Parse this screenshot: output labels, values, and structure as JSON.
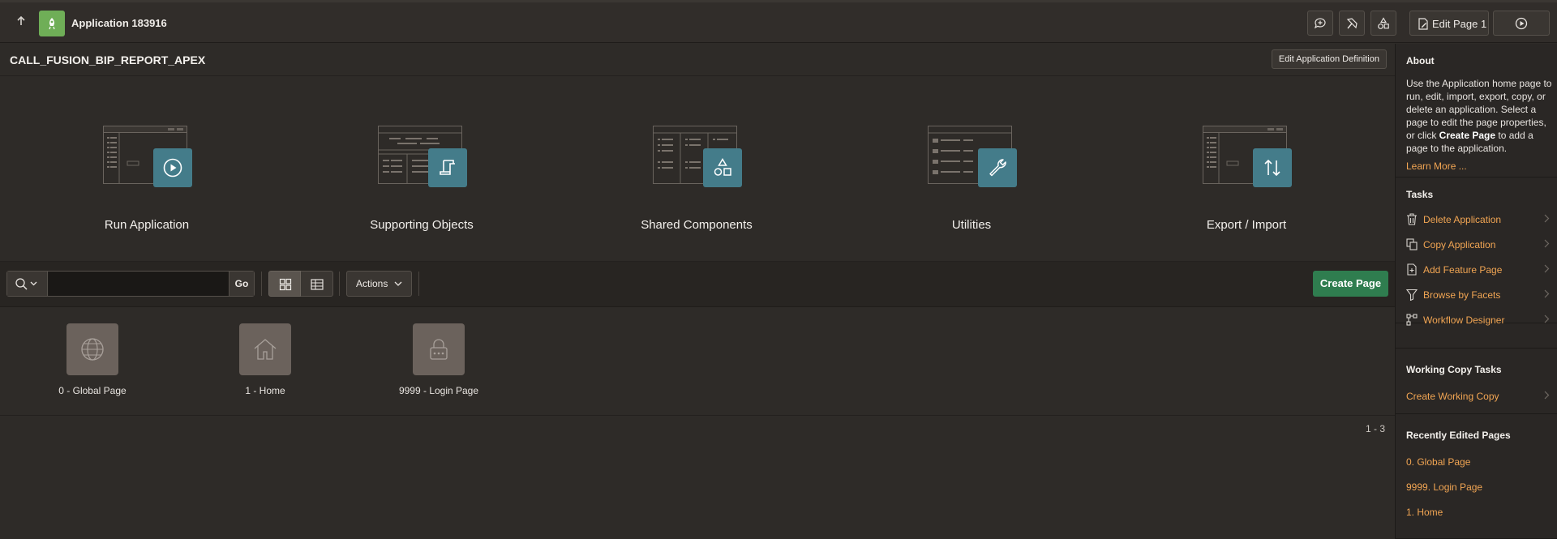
{
  "header": {
    "app_title": "Application 183916",
    "edit_page_label": "Edit Page 1",
    "icon_names": [
      "up-arrow-icon",
      "rocket-icon",
      "comment-add-icon",
      "flashlight-icon",
      "shapes-icon",
      "page-edit-icon",
      "play-circle-icon"
    ]
  },
  "app": {
    "name": "CALL_FUSION_BIP_REPORT_APEX",
    "edit_definition_label": "Edit Application Definition"
  },
  "main_actions": [
    {
      "label": "Run Application",
      "icon": "play-circle-icon"
    },
    {
      "label": "Supporting Objects",
      "icon": "scroll-icon"
    },
    {
      "label": "Shared Components",
      "icon": "shapes-icon"
    },
    {
      "label": "Utilities",
      "icon": "wrench-icon"
    },
    {
      "label": "Export / Import",
      "icon": "arrows-up-down-icon"
    }
  ],
  "toolbar": {
    "search_value": "",
    "search_placeholder": "",
    "go_label": "Go",
    "actions_label": "Actions",
    "create_page_label": "Create Page"
  },
  "pages": [
    {
      "label": "0 - Global Page",
      "icon": "globe-icon"
    },
    {
      "label": "1 - Home",
      "icon": "home-icon"
    },
    {
      "label": "9999 - Login Page",
      "icon": "lock-icon"
    }
  ],
  "pagination": "1 - 3",
  "sidebar": {
    "about": {
      "title": "About",
      "text_before": "Use the Application home page to run, edit, import, export, copy, or delete an application. Select a page to edit the page properties, or click ",
      "text_bold": "Create Page",
      "text_after": " to add a page to the application.",
      "learn_more": "Learn More ..."
    },
    "tasks": {
      "title": "Tasks",
      "items": [
        {
          "label": "Delete Application",
          "icon": "trash-icon"
        },
        {
          "label": "Copy Application",
          "icon": "copy-icon"
        },
        {
          "label": "Add Feature Page",
          "icon": "file-add-icon"
        },
        {
          "label": "Browse by Facets",
          "icon": "filter-icon"
        },
        {
          "label": "Workflow Designer",
          "icon": "workflow-icon"
        }
      ]
    },
    "working_copy": {
      "title": "Working Copy Tasks",
      "items": [
        {
          "label": "Create Working Copy"
        }
      ]
    },
    "recent": {
      "title": "Recently Edited Pages",
      "items": [
        {
          "label": "0. Global Page"
        },
        {
          "label": "9999. Login Page"
        },
        {
          "label": "1. Home"
        }
      ]
    }
  },
  "colors": {
    "background": "#2e2b28",
    "link": "#f1a553",
    "create_button": "#2f7d4f",
    "tile_blue": "#447c8a",
    "app_badge": "#6fae57"
  }
}
